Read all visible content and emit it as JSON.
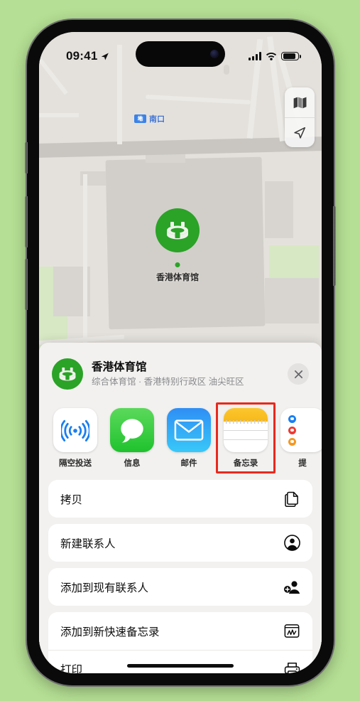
{
  "background_color": "#b5df94",
  "status_bar": {
    "time": "09:41",
    "location_arrow_icon": "location-arrow-icon",
    "cellular_icon": "cellular-signal-icon",
    "wifi_icon": "wifi-icon",
    "battery_icon": "battery-icon"
  },
  "map": {
    "transit_label": "南口",
    "transit_badge_text": "地",
    "poi_name": "香港体育馆",
    "poi_pin_icon": "stadium-pin-icon",
    "controls": [
      {
        "name": "map-layers-button",
        "icon": "map-icon"
      },
      {
        "name": "user-location-button",
        "icon": "location-arrow-icon"
      }
    ]
  },
  "share_sheet": {
    "title": "香港体育馆",
    "subtitle": "综合体育馆 · 香港特别行政区 油尖旺区",
    "avatar_icon": "stadium-icon",
    "close_icon": "close-icon",
    "highlight_color": "#e8291d",
    "apps": [
      {
        "label": "隔空投送",
        "icon": "airdrop-icon",
        "highlighted": false
      },
      {
        "label": "信息",
        "icon": "messages-icon",
        "highlighted": false
      },
      {
        "label": "邮件",
        "icon": "mail-icon",
        "highlighted": false
      },
      {
        "label": "备忘录",
        "icon": "notes-icon",
        "highlighted": true
      },
      {
        "label": "提",
        "icon": "reminders-icon",
        "highlighted": false
      }
    ],
    "actions": [
      {
        "label": "拷贝",
        "icon": "copy-icon"
      },
      {
        "label": "新建联系人",
        "icon": "person-circle-icon"
      },
      {
        "label": "添加到现有联系人",
        "icon": "person-add-icon"
      },
      {
        "label": "添加到新快速备忘录",
        "icon": "quick-note-icon"
      },
      {
        "label": "打印",
        "icon": "printer-icon"
      }
    ]
  }
}
